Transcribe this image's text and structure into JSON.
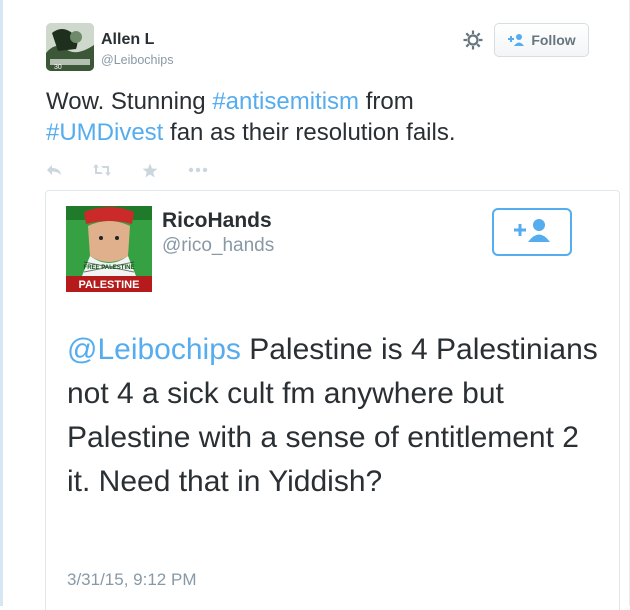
{
  "outer_tweet": {
    "author_name": "Allen L",
    "author_handle": "@Leibochips",
    "text_part1": "Wow. Stunning ",
    "hashtag1": "#antisemitism",
    "text_part2": " from",
    "hashtag2": "#UMDivest",
    "text_part3": " fan as their resolution fails.",
    "follow_label": "Follow",
    "actions": [
      "reply-icon",
      "retweet-icon",
      "favorite-icon",
      "more-icon"
    ]
  },
  "embedded_tweet": {
    "author_name": "RicoHands",
    "author_handle": "@rico_hands",
    "avatar_text_top": "FREE PALESTINE",
    "avatar_text_bottom": "PALESTINE",
    "mention": "@Leibochips",
    "text": " Palestine is 4 Palestinians not 4 a sick cult fm anywhere but Palestine with a sense of entitlement 2 it. Need that in Yiddish?",
    "timestamp": "3/31/15, 9:12 PM"
  },
  "colors": {
    "link": "#55acee",
    "text": "#292f33",
    "muted": "#8899a6"
  }
}
